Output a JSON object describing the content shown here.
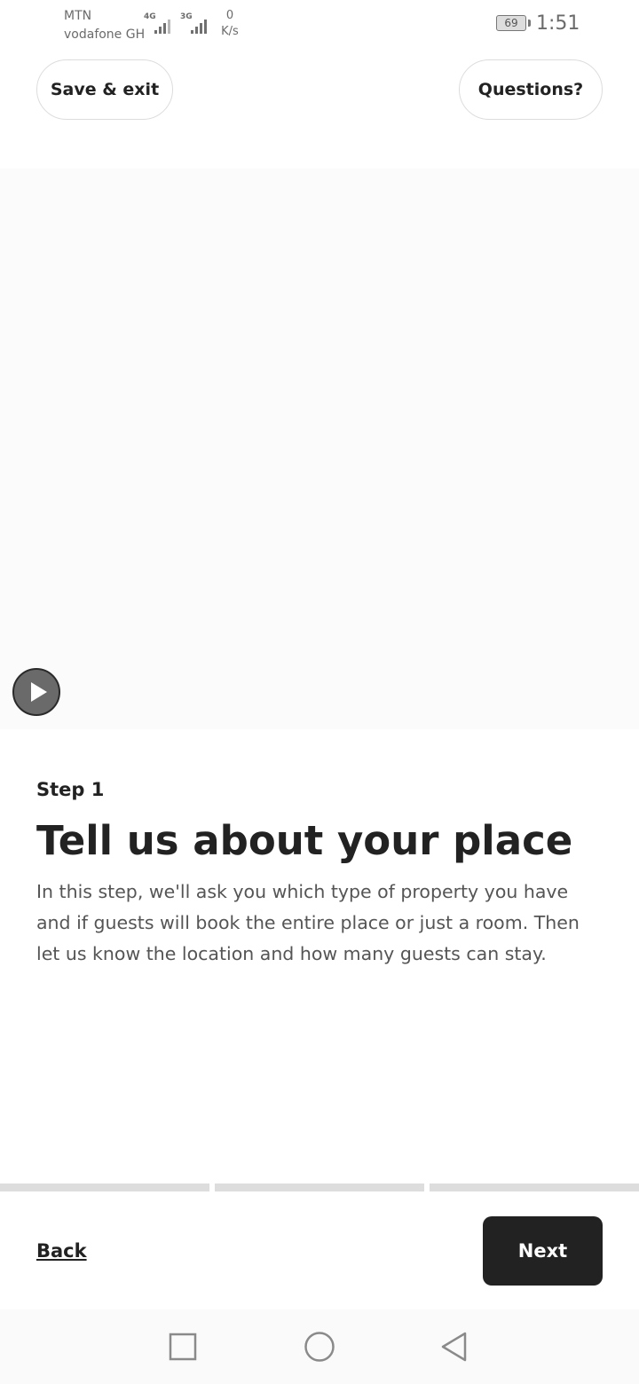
{
  "status_bar": {
    "carrier_1": "MTN",
    "carrier_2": "vodafone GH",
    "network_1": "4G",
    "network_2": "3G",
    "speed_value": "0",
    "speed_unit": "K/s",
    "battery": "69",
    "time": "1:51"
  },
  "header": {
    "save_exit_label": "Save & exit",
    "questions_label": "Questions?"
  },
  "media": {
    "play_icon": "play-icon"
  },
  "content": {
    "step_label": "Step 1",
    "title": "Tell us about your place",
    "description": "In this step, we'll ask you which type of property you have and if guests will book the entire place or just a room. Then let us know the location and how many guests can stay."
  },
  "progress": {
    "segments": [
      0,
      0,
      0
    ]
  },
  "footer": {
    "back_label": "Back",
    "next_label": "Next"
  },
  "nav_bar": {
    "recents_icon": "square-recents-icon",
    "home_icon": "circle-home-icon",
    "back_icon": "triangle-back-icon"
  },
  "colors": {
    "text_primary": "#222222",
    "text_secondary": "#555555",
    "next_button_bg": "#222222",
    "progress_track": "#dddddd"
  }
}
